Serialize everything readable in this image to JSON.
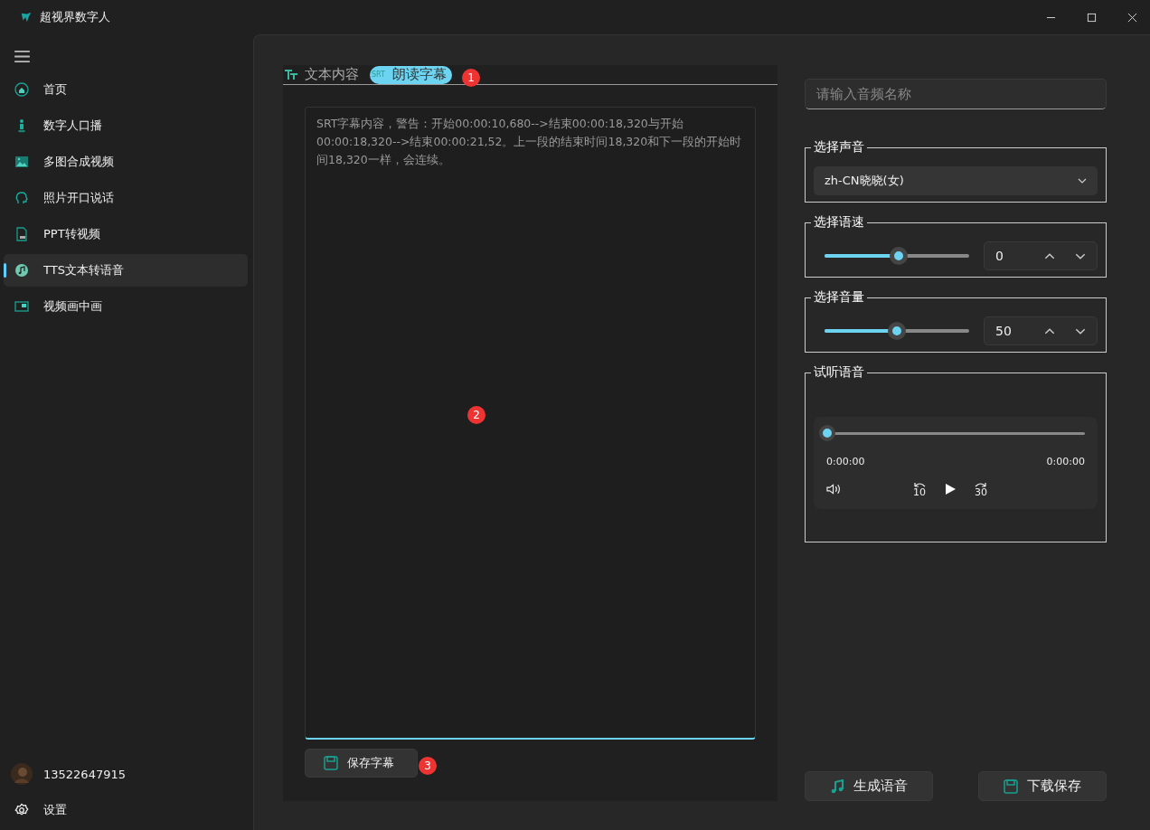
{
  "window": {
    "title": "超视界数字人"
  },
  "sidebar": {
    "items": [
      {
        "label": "首页",
        "selected": false
      },
      {
        "label": "数字人口播",
        "selected": false
      },
      {
        "label": "多图合成视频",
        "selected": false
      },
      {
        "label": "照片开口说话",
        "selected": false
      },
      {
        "label": "PPT转视频",
        "selected": false
      },
      {
        "label": "TTS文本转语音",
        "selected": true
      },
      {
        "label": "视频画中画",
        "selected": false
      }
    ],
    "user": "13522647915",
    "settings": "设置"
  },
  "tabs": [
    {
      "label": "文本内容",
      "selected": false
    },
    {
      "label": "朗读字幕",
      "icon_text": "SRT",
      "selected": true
    }
  ],
  "editor": {
    "value": "SRT字幕内容，警告：开始00:00:10,680-->结束00:00:18,320与开始00:00:18,320-->结束00:00:21,52。上一段的结束时间18,320和下一段的开始时间18,320一样，会连续。"
  },
  "save_button": "保存字幕",
  "name_field": {
    "placeholder": "请输入音频名称"
  },
  "voice": {
    "legend": "选择声音",
    "value": "zh-CN晓晓(女)"
  },
  "speed": {
    "legend": "选择语速",
    "level": 0.51,
    "value": "0"
  },
  "volume": {
    "legend": "选择音量",
    "level": 0.5,
    "value": "50"
  },
  "preview": {
    "legend": "试听语音",
    "level": 0,
    "current": "0:00:00",
    "total": "0:00:00",
    "back": "10",
    "forward": "30"
  },
  "actions": [
    {
      "label": "生成语音"
    },
    {
      "label": "下载保存"
    }
  ],
  "markers": [
    "1",
    "2",
    "3"
  ]
}
